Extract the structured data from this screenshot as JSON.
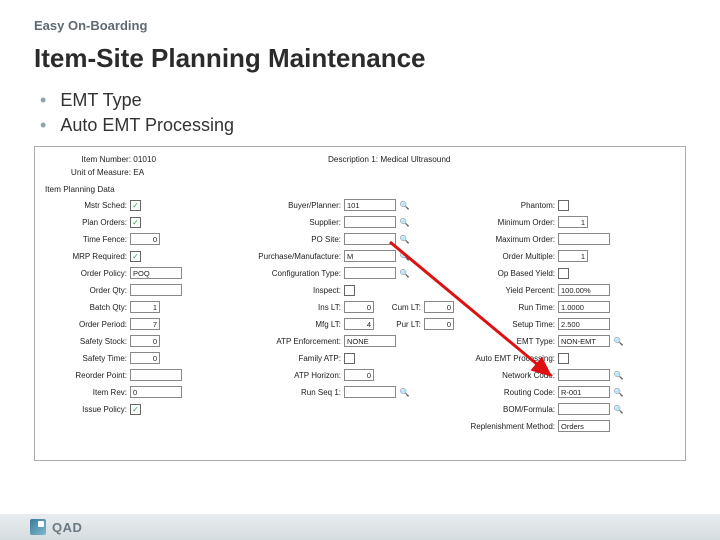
{
  "slide": {
    "preTitle": "Easy On-Boarding",
    "title": "Item-Site Planning Maintenance",
    "bullets": [
      "EMT Type",
      "Auto EMT Processing"
    ]
  },
  "form": {
    "header": {
      "itemNumberLabel": "Item Number:",
      "itemNumberValue": "01010",
      "descLabel": "Description 1:",
      "descValue": "Medical Ultrasound",
      "umLabel": "Unit of Measure:",
      "umValue": "EA"
    },
    "sectionTitle": "Item Planning Data",
    "col1": [
      {
        "label": "Mstr Sched:",
        "type": "chk",
        "value": "✓"
      },
      {
        "label": "Plan Orders:",
        "type": "chk",
        "value": "✓"
      },
      {
        "label": "Time Fence:",
        "type": "num",
        "value": "0"
      },
      {
        "label": "MRP Required:",
        "type": "chk",
        "value": "✓"
      },
      {
        "label": "Order Policy:",
        "type": "txt",
        "value": "POQ"
      },
      {
        "label": "Order Qty:",
        "type": "txt",
        "value": ""
      },
      {
        "label": "Batch Qty:",
        "type": "num",
        "value": "1"
      },
      {
        "label": "Order Period:",
        "type": "num",
        "value": "7"
      },
      {
        "label": "Safety Stock:",
        "type": "num",
        "value": "0"
      },
      {
        "label": "Safety Time:",
        "type": "num",
        "value": "0"
      },
      {
        "label": "Reorder Point:",
        "type": "txt",
        "value": ""
      },
      {
        "label": "Item Rev:",
        "type": "txt",
        "value": "0"
      },
      {
        "label": "Issue Policy:",
        "type": "chk",
        "value": "✓"
      }
    ],
    "col2": [
      {
        "label": "Buyer/Planner:",
        "type": "lookup",
        "value": "101"
      },
      {
        "label": "Supplier:",
        "type": "lookup",
        "value": ""
      },
      {
        "label": "PO Site:",
        "type": "lookup",
        "value": ""
      },
      {
        "label": "Purchase/Manufacture:",
        "type": "lookup",
        "value": "M"
      },
      {
        "label": "Configuration Type:",
        "type": "lookup",
        "value": ""
      },
      {
        "label": "Inspect:",
        "type": "chk",
        "value": ""
      },
      {
        "label": "Ins LT:",
        "type": "num",
        "value": "0"
      },
      {
        "label": "Mfg LT:",
        "type": "num",
        "value": "4"
      },
      {
        "label": "ATP Enforcement:",
        "type": "txt",
        "value": "NONE"
      },
      {
        "label": "Family ATP:",
        "type": "chk",
        "value": ""
      },
      {
        "label": "ATP Horizon:",
        "type": "num",
        "value": "0"
      },
      {
        "label": "Run Seq 1:",
        "type": "lookup",
        "value": ""
      }
    ],
    "col2b": [
      {
        "label": "Cum LT:",
        "type": "num",
        "value": "0"
      },
      {
        "label": "Pur LT:",
        "type": "num",
        "value": "0"
      }
    ],
    "col3": [
      {
        "label": "Phantom:",
        "type": "chk",
        "value": ""
      },
      {
        "label": "Minimum Order:",
        "type": "num",
        "value": "1"
      },
      {
        "label": "Maximum Order:",
        "type": "txt",
        "value": ""
      },
      {
        "label": "Order Multiple:",
        "type": "num",
        "value": "1"
      },
      {
        "label": "Op Based Yield:",
        "type": "chk",
        "value": ""
      },
      {
        "label": "Yield Percent:",
        "type": "txt",
        "value": "100.00%"
      },
      {
        "label": "Run Time:",
        "type": "txt",
        "value": "1.0000"
      },
      {
        "label": "Setup Time:",
        "type": "txt",
        "value": "2.500"
      },
      {
        "label": "EMT Type:",
        "type": "lookup",
        "value": "NON-EMT"
      },
      {
        "label": "Auto EMT Processing:",
        "type": "chk",
        "value": ""
      },
      {
        "label": "Network Code:",
        "type": "lookup",
        "value": ""
      },
      {
        "label": "Routing Code:",
        "type": "lookup",
        "value": "R-001"
      },
      {
        "label": "BOM/Formula:",
        "type": "lookup",
        "value": ""
      },
      {
        "label": "Replenishment Method:",
        "type": "txt",
        "value": "Orders"
      }
    ]
  },
  "footer": {
    "brand": "QAD"
  }
}
